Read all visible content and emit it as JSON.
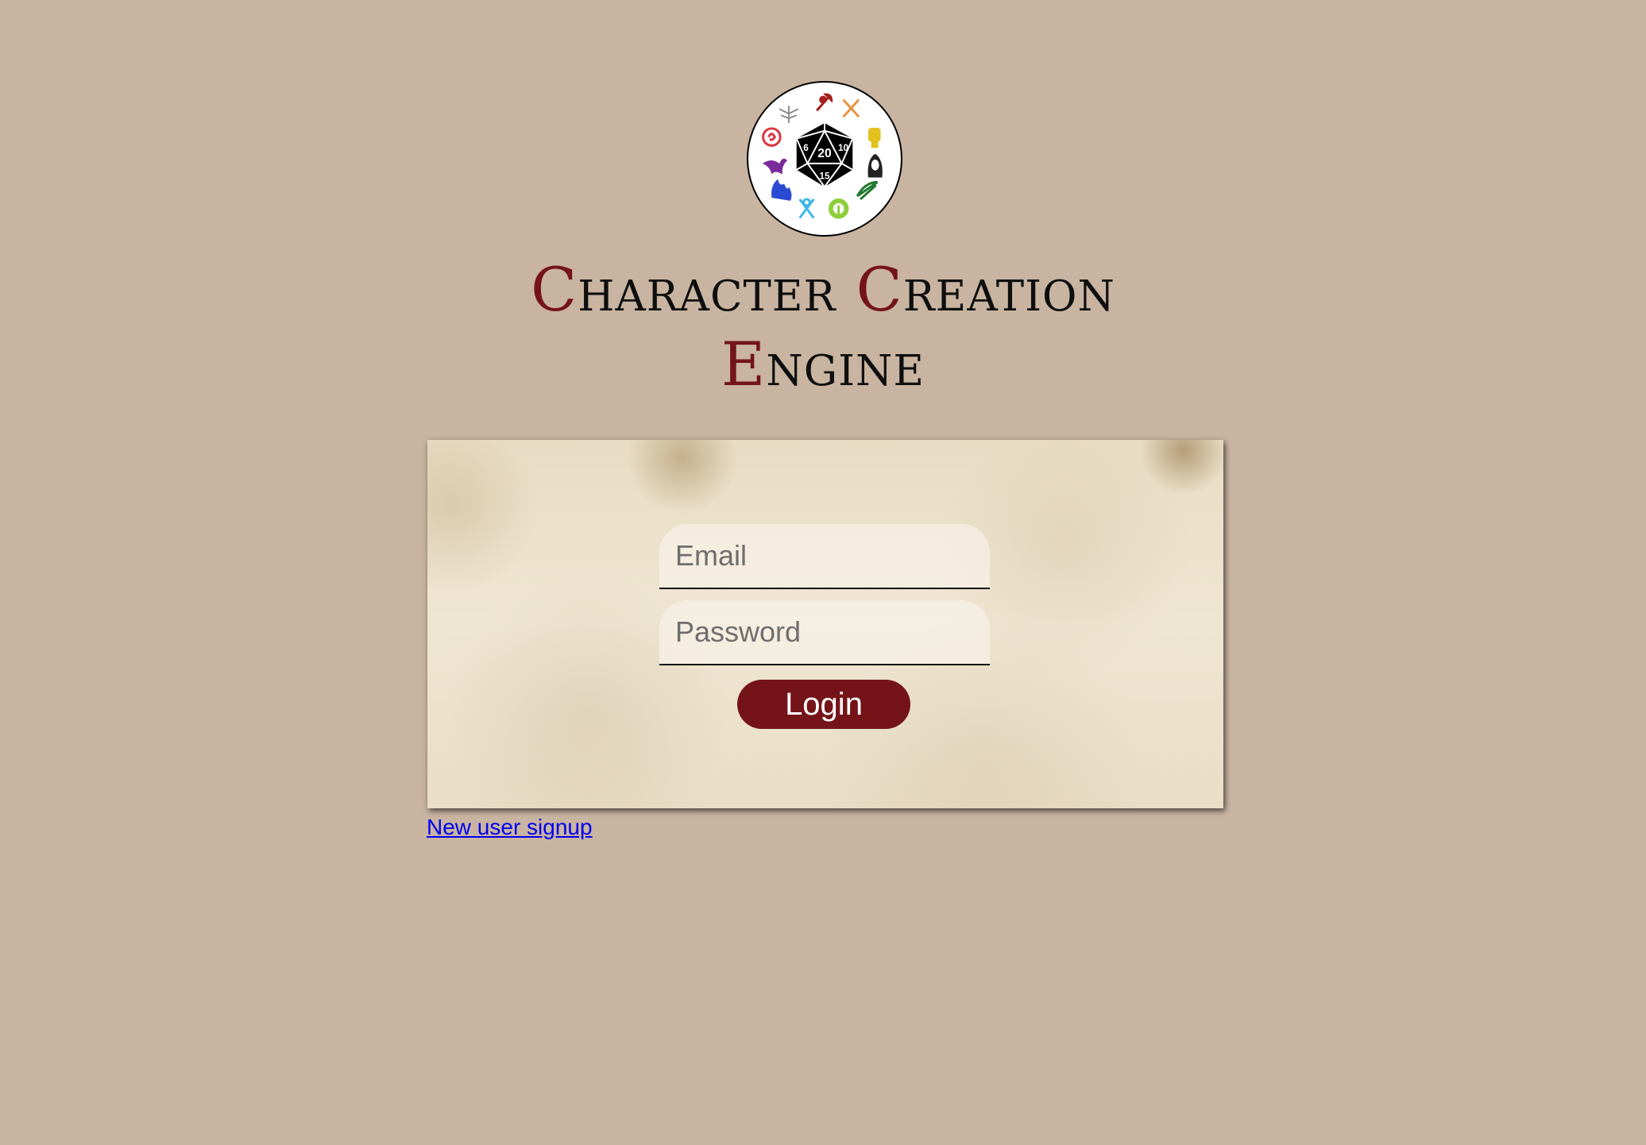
{
  "logo": {
    "die_numbers": [
      "20",
      "6",
      "10",
      "15"
    ],
    "icons": [
      "winged-sword-icon",
      "axe-icon",
      "crossed-swords-icon",
      "fist-icon",
      "hooded-figure-icon",
      "bow-icon",
      "leaf-icon",
      "ankh-icon",
      "flame-icon",
      "dragon-icon",
      "spiral-hand-icon"
    ]
  },
  "title": {
    "words": [
      {
        "initial": "C",
        "rest": "haracter"
      },
      {
        "initial": "C",
        "rest": "reation"
      },
      {
        "initial": "E",
        "rest": "ngine"
      }
    ]
  },
  "login_form": {
    "email_placeholder": "Email",
    "password_placeholder": "Password",
    "login_label": "Login"
  },
  "signup": {
    "link_text": "New user signup"
  },
  "colors": {
    "page_background": "#c8b4a1",
    "accent": "#741419",
    "card_background": "#ece1ca",
    "link": "#0000ee"
  }
}
